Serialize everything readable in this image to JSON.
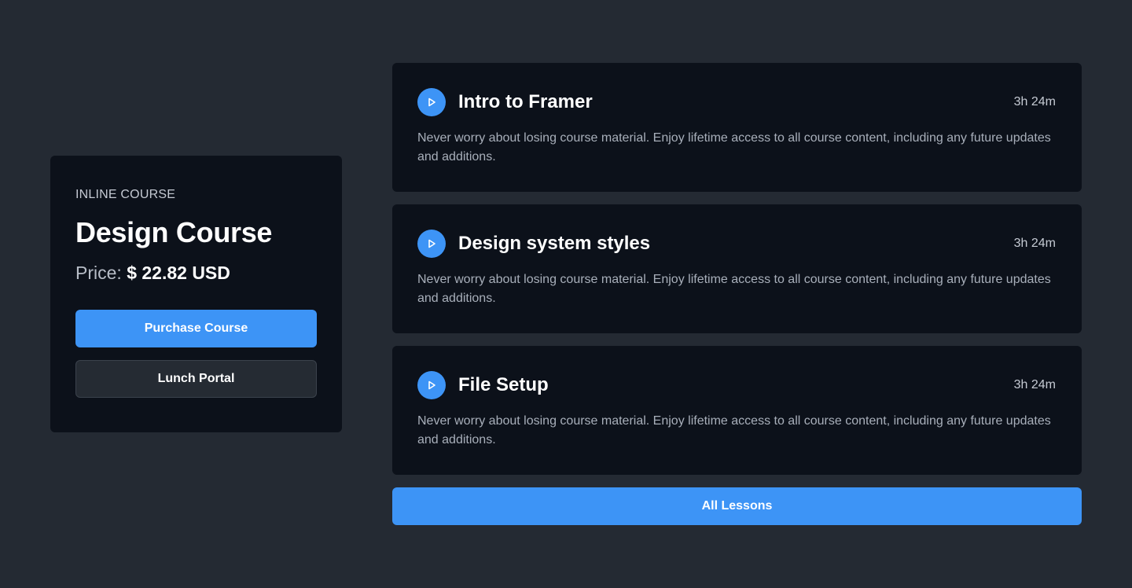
{
  "course": {
    "eyebrow": "INLINE COURSE",
    "title": "Design Course",
    "price_label": "Price:",
    "price_amount": "$ 22.82 USD",
    "purchase_label": "Purchase Course",
    "portal_label": "Lunch Portal"
  },
  "lessons": [
    {
      "title": "Intro to Framer",
      "duration": "3h 24m",
      "description": "Never worry about losing course material. Enjoy lifetime access to all course content, including any future updates and additions."
    },
    {
      "title": "Design system styles",
      "duration": "3h 24m",
      "description": "Never worry about losing course material. Enjoy lifetime access to all course content, including any future updates and additions."
    },
    {
      "title": "File Setup",
      "duration": "3h 24m",
      "description": "Never worry about losing course material. Enjoy lifetime access to all course content, including any future updates and additions."
    }
  ],
  "all_lessons_label": "All Lessons",
  "icons": {
    "play": "play-icon"
  },
  "colors": {
    "background": "#242a33",
    "card": "#0c111a",
    "accent": "#3d94f6"
  }
}
